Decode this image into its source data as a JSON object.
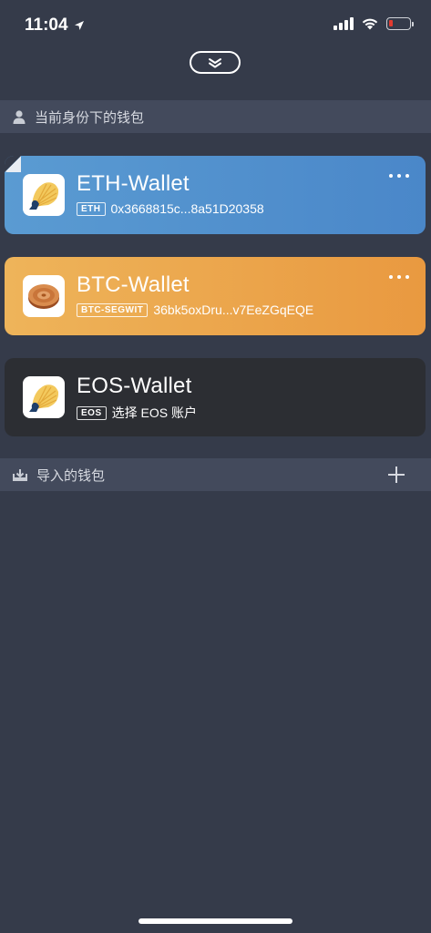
{
  "status_bar": {
    "time": "11:04",
    "icons": [
      "location-arrow-icon",
      "cellular-signal-icon",
      "wifi-icon",
      "battery-icon"
    ],
    "battery_level": 0.2
  },
  "collapse_icon": "chevron-double-down-icon",
  "current_section": {
    "icon": "person-icon",
    "title": "当前身份下的钱包"
  },
  "wallets": [
    {
      "name": "ETH-Wallet",
      "chain": "ETH",
      "address": "0x3668815c...8a51D20358",
      "color": "#4a87c9",
      "logo": "shell-logo-icon",
      "more": "more-dots-icon"
    },
    {
      "name": "BTC-Wallet",
      "chain": "BTC-SEGWIT",
      "address": "36bk5oxDru...v7EeZGqEQE",
      "color": "#e99940",
      "logo": "coin-logo-icon",
      "more": "more-dots-icon"
    },
    {
      "name": "EOS-Wallet",
      "chain": "EOS",
      "address": "选择 EOS 账户",
      "color": "#2c2e33",
      "logo": "shell-logo-icon"
    }
  ],
  "imported_section": {
    "icon": "download-icon",
    "title": "导入的钱包",
    "add_icon": "plus-icon"
  }
}
